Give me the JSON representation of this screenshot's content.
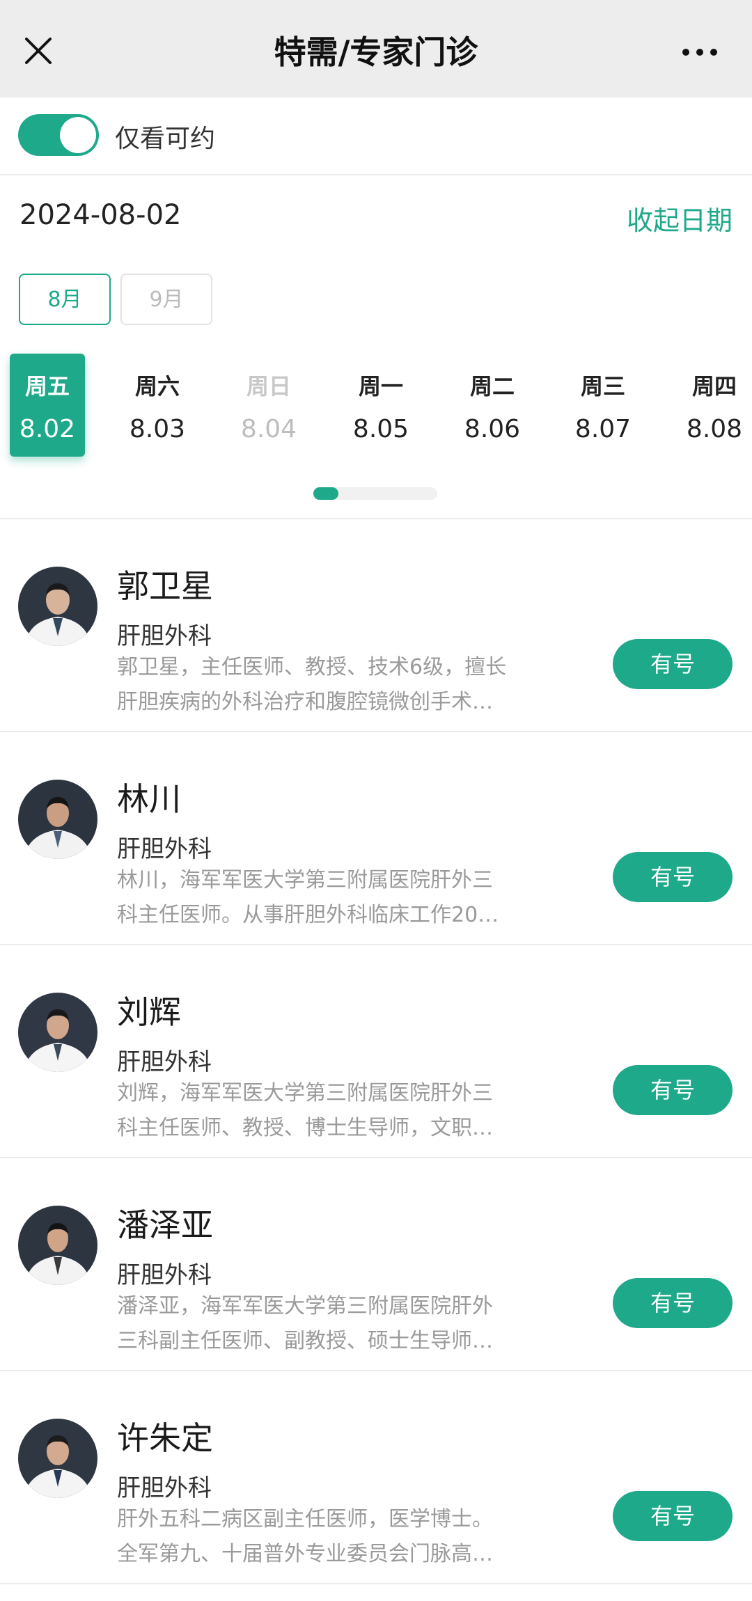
{
  "nav": {
    "title": "特需/专家门诊"
  },
  "filter": {
    "label": "仅看可约",
    "enabled": true
  },
  "date_header": {
    "current_date": "2024-08-02",
    "collapse_label": "收起日期"
  },
  "months": [
    {
      "label": "8月",
      "selected": true
    },
    {
      "label": "9月",
      "selected": false
    }
  ],
  "days": [
    {
      "weekday": "周五",
      "date": "8.02",
      "state": "selected"
    },
    {
      "weekday": "周六",
      "date": "8.03",
      "state": "normal"
    },
    {
      "weekday": "周日",
      "date": "8.04",
      "state": "disabled"
    },
    {
      "weekday": "周一",
      "date": "8.05",
      "state": "normal"
    },
    {
      "weekday": "周二",
      "date": "8.06",
      "state": "normal"
    },
    {
      "weekday": "周三",
      "date": "8.07",
      "state": "normal"
    },
    {
      "weekday": "周四",
      "date": "8.08",
      "state": "normal"
    }
  ],
  "doctors": [
    {
      "name": "郭卫星",
      "dept": "肝胆外科",
      "desc_line1": "郭卫星，主任医师、教授、技术6级，擅长",
      "desc_line2": "肝胆疾病的外科治疗和腹腔镜微创手术…",
      "button": "有号"
    },
    {
      "name": "林川",
      "dept": "肝胆外科",
      "desc_line1": "林川，海军军医大学第三附属医院肝外三",
      "desc_line2": "科主任医师。从事肝胆外科临床工作20…",
      "button": "有号"
    },
    {
      "name": "刘辉",
      "dept": "肝胆外科",
      "desc_line1": "刘辉，海军军医大学第三附属医院肝外三",
      "desc_line2": "科主任医师、教授、博士生导师，文职…",
      "button": "有号"
    },
    {
      "name": "潘泽亚",
      "dept": "肝胆外科",
      "desc_line1": "潘泽亚，海军军医大学第三附属医院肝外",
      "desc_line2": "三科副主任医师、副教授、硕士生导师…",
      "button": "有号"
    },
    {
      "name": "许朱定",
      "dept": "肝胆外科",
      "desc_line1": "肝外五科二病区副主任医师，医学博士。",
      "desc_line2": "全军第九、十届普外专业委员会门脉高…",
      "button": "有号"
    }
  ],
  "colors": {
    "accent": "#1ea98a",
    "nav_bg": "#ededed",
    "muted_text": "#9a9a9a"
  }
}
